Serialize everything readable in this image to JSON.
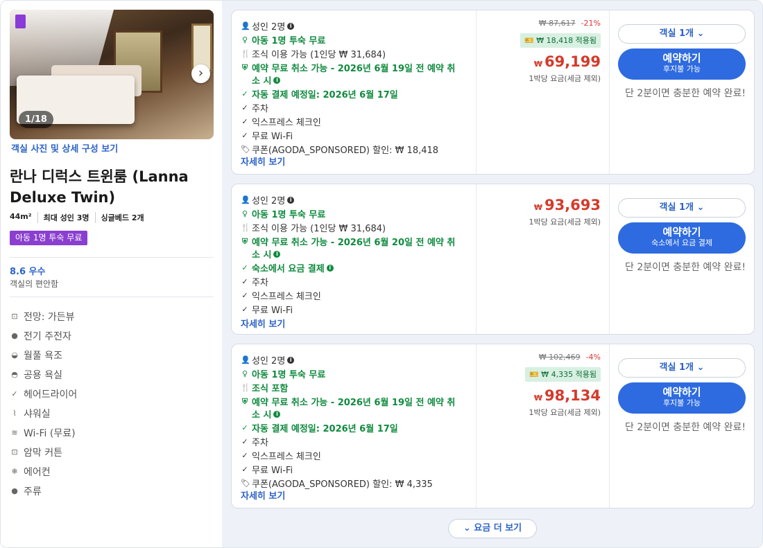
{
  "room": {
    "photo_counter": "1/18",
    "photo_link": "객실 사진 및 상세 구성 보기",
    "title": "란나 디럭스 트윈룸 (Lanna Deluxe Twin)",
    "specs": [
      "44m²",
      "최대 성인 3명",
      "싱글베드 2개"
    ],
    "kid_badge": "아동 1명 투숙 무료",
    "score": "8.6 우수",
    "score_label": "객실의 편안함",
    "amenities": [
      {
        "icon": "view-icon",
        "label": "전망: 가든뷰"
      },
      {
        "icon": "bike-icon",
        "label": "전기 주전자"
      },
      {
        "icon": "bathtub-icon",
        "label": "월풀 욕조"
      },
      {
        "icon": "bath-icon",
        "label": "공용 욕실"
      },
      {
        "icon": "check-icon",
        "label": "헤어드라이어"
      },
      {
        "icon": "shower-icon",
        "label": "샤워실"
      },
      {
        "icon": "wifi-icon",
        "label": "Wi-Fi (무료)"
      },
      {
        "icon": "curtain-icon",
        "label": "암막 커튼"
      },
      {
        "icon": "ac-icon",
        "label": "에어컨"
      },
      {
        "icon": "bar-icon",
        "label": "주류"
      }
    ]
  },
  "offers": [
    {
      "guests": "성인 2명",
      "kids_free": "아동 1명 투숙 무료",
      "meal": "조식 이용 가능 (1인당 ₩ 31,684)",
      "cancel_1": "예약 무료 취소 가능 - 2026년 6월 19일 전 예약 취",
      "cancel_2": "소 시",
      "payment": "자동 결제 예정일: 2026년 6월 17일",
      "features": [
        "주차",
        "익스프레스 체크인",
        "무료 Wi-Fi"
      ],
      "coupon_line": "쿠폰(AGODA_SPONSORED) 할인: ₩ 18,418",
      "details": "자세히 보기",
      "old_price": "₩ 87,617",
      "discount": "-21%",
      "coupon_applied": "₩ 18,418 적용됨",
      "currency": "₩",
      "price": "69,199",
      "per_night": "1박당 요금(세금 제외)",
      "rooms": "객실 1개",
      "book": "예약하기",
      "book_sub": "후지불 가능",
      "hint": "단 2분이면 충분한 예약 완료!"
    },
    {
      "guests": "성인 2명",
      "kids_free": "아동 1명 투숙 무료",
      "meal": "조식 이용 가능 (1인당 ₩ 31,684)",
      "cancel_1": "예약 무료 취소 가능 - 2026년 6월 20일 전 예약 취",
      "cancel_2": "소 시",
      "payment": "숙소에서 요금 결제",
      "features": [
        "주차",
        "익스프레스 체크인",
        "무료 Wi-Fi"
      ],
      "details": "자세히 보기",
      "currency": "₩",
      "price": "93,693",
      "per_night": "1박당 요금(세금 제외)",
      "rooms": "객실 1개",
      "book": "예약하기",
      "book_sub": "숙소에서 요금 결제",
      "hint": "단 2분이면 충분한 예약 완료!"
    },
    {
      "guests": "성인 2명",
      "kids_free": "아동 1명 투숙 무료",
      "meal": "조식 포함",
      "cancel_1": "예약 무료 취소 가능 - 2026년 6월 19일 전 예약 취",
      "cancel_2": "소 시",
      "payment": "자동 결제 예정일: 2026년 6월 17일",
      "features": [
        "주차",
        "익스프레스 체크인",
        "무료 Wi-Fi"
      ],
      "coupon_line": "쿠폰(AGODA_SPONSORED) 할인: ₩ 4,335",
      "details": "자세히 보기",
      "old_price": "₩ 102,469",
      "discount": "-4%",
      "coupon_applied": "₩ 4,335 적용됨",
      "currency": "₩",
      "price": "98,134",
      "per_night": "1박당 요금(세금 제외)",
      "rooms": "객실 1개",
      "book": "예약하기",
      "book_sub": "후지불 가능",
      "hint": "단 2분이면 충분한 예약 완료!"
    }
  ],
  "more_rates": "요금 더 보기",
  "colors": {
    "accent": "#2e6be0",
    "price": "#d43a2b",
    "green": "#0f8a3e",
    "badge": "#8a3fd0"
  }
}
